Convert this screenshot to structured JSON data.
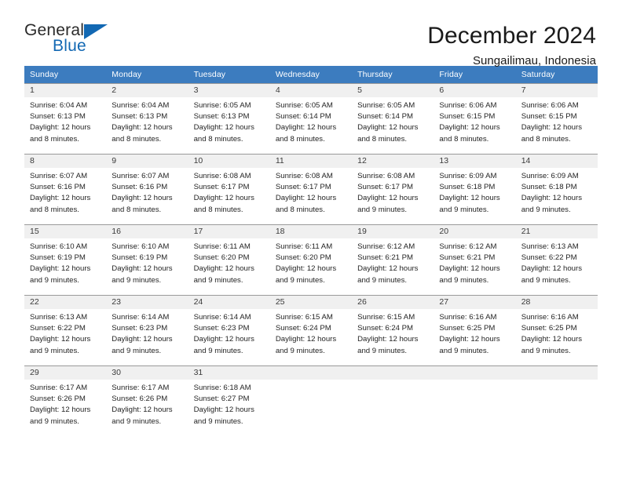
{
  "logo": {
    "primary_text": "General",
    "secondary_text": "Blue",
    "triangle_icon": "blue-triangle-icon",
    "primary_color": "#2a2a2a",
    "accent_color": "#1268b3"
  },
  "header": {
    "title": "December 2024",
    "subtitle": "Sungailimau, Indonesia"
  },
  "theme": {
    "header_blue": "#3c7cbf",
    "daynum_band": "#f0f0f0",
    "grid_line": "#9a9a9a",
    "text": "#242424"
  },
  "calendar": {
    "weekday_headers": [
      "Sunday",
      "Monday",
      "Tuesday",
      "Wednesday",
      "Thursday",
      "Friday",
      "Saturday"
    ],
    "labels": {
      "sunrise_prefix": "Sunrise:",
      "sunset_prefix": "Sunset:",
      "daylight_prefix": "Daylight:"
    },
    "weeks": [
      [
        {
          "day": "1",
          "sunrise": "Sunrise: 6:04 AM",
          "sunset": "Sunset: 6:13 PM",
          "daylight_line1": "Daylight: 12 hours",
          "daylight_line2": "and 8 minutes."
        },
        {
          "day": "2",
          "sunrise": "Sunrise: 6:04 AM",
          "sunset": "Sunset: 6:13 PM",
          "daylight_line1": "Daylight: 12 hours",
          "daylight_line2": "and 8 minutes."
        },
        {
          "day": "3",
          "sunrise": "Sunrise: 6:05 AM",
          "sunset": "Sunset: 6:13 PM",
          "daylight_line1": "Daylight: 12 hours",
          "daylight_line2": "and 8 minutes."
        },
        {
          "day": "4",
          "sunrise": "Sunrise: 6:05 AM",
          "sunset": "Sunset: 6:14 PM",
          "daylight_line1": "Daylight: 12 hours",
          "daylight_line2": "and 8 minutes."
        },
        {
          "day": "5",
          "sunrise": "Sunrise: 6:05 AM",
          "sunset": "Sunset: 6:14 PM",
          "daylight_line1": "Daylight: 12 hours",
          "daylight_line2": "and 8 minutes."
        },
        {
          "day": "6",
          "sunrise": "Sunrise: 6:06 AM",
          "sunset": "Sunset: 6:15 PM",
          "daylight_line1": "Daylight: 12 hours",
          "daylight_line2": "and 8 minutes."
        },
        {
          "day": "7",
          "sunrise": "Sunrise: 6:06 AM",
          "sunset": "Sunset: 6:15 PM",
          "daylight_line1": "Daylight: 12 hours",
          "daylight_line2": "and 8 minutes."
        }
      ],
      [
        {
          "day": "8",
          "sunrise": "Sunrise: 6:07 AM",
          "sunset": "Sunset: 6:16 PM",
          "daylight_line1": "Daylight: 12 hours",
          "daylight_line2": "and 8 minutes."
        },
        {
          "day": "9",
          "sunrise": "Sunrise: 6:07 AM",
          "sunset": "Sunset: 6:16 PM",
          "daylight_line1": "Daylight: 12 hours",
          "daylight_line2": "and 8 minutes."
        },
        {
          "day": "10",
          "sunrise": "Sunrise: 6:08 AM",
          "sunset": "Sunset: 6:17 PM",
          "daylight_line1": "Daylight: 12 hours",
          "daylight_line2": "and 8 minutes."
        },
        {
          "day": "11",
          "sunrise": "Sunrise: 6:08 AM",
          "sunset": "Sunset: 6:17 PM",
          "daylight_line1": "Daylight: 12 hours",
          "daylight_line2": "and 8 minutes."
        },
        {
          "day": "12",
          "sunrise": "Sunrise: 6:08 AM",
          "sunset": "Sunset: 6:17 PM",
          "daylight_line1": "Daylight: 12 hours",
          "daylight_line2": "and 9 minutes."
        },
        {
          "day": "13",
          "sunrise": "Sunrise: 6:09 AM",
          "sunset": "Sunset: 6:18 PM",
          "daylight_line1": "Daylight: 12 hours",
          "daylight_line2": "and 9 minutes."
        },
        {
          "day": "14",
          "sunrise": "Sunrise: 6:09 AM",
          "sunset": "Sunset: 6:18 PM",
          "daylight_line1": "Daylight: 12 hours",
          "daylight_line2": "and 9 minutes."
        }
      ],
      [
        {
          "day": "15",
          "sunrise": "Sunrise: 6:10 AM",
          "sunset": "Sunset: 6:19 PM",
          "daylight_line1": "Daylight: 12 hours",
          "daylight_line2": "and 9 minutes."
        },
        {
          "day": "16",
          "sunrise": "Sunrise: 6:10 AM",
          "sunset": "Sunset: 6:19 PM",
          "daylight_line1": "Daylight: 12 hours",
          "daylight_line2": "and 9 minutes."
        },
        {
          "day": "17",
          "sunrise": "Sunrise: 6:11 AM",
          "sunset": "Sunset: 6:20 PM",
          "daylight_line1": "Daylight: 12 hours",
          "daylight_line2": "and 9 minutes."
        },
        {
          "day": "18",
          "sunrise": "Sunrise: 6:11 AM",
          "sunset": "Sunset: 6:20 PM",
          "daylight_line1": "Daylight: 12 hours",
          "daylight_line2": "and 9 minutes."
        },
        {
          "day": "19",
          "sunrise": "Sunrise: 6:12 AM",
          "sunset": "Sunset: 6:21 PM",
          "daylight_line1": "Daylight: 12 hours",
          "daylight_line2": "and 9 minutes."
        },
        {
          "day": "20",
          "sunrise": "Sunrise: 6:12 AM",
          "sunset": "Sunset: 6:21 PM",
          "daylight_line1": "Daylight: 12 hours",
          "daylight_line2": "and 9 minutes."
        },
        {
          "day": "21",
          "sunrise": "Sunrise: 6:13 AM",
          "sunset": "Sunset: 6:22 PM",
          "daylight_line1": "Daylight: 12 hours",
          "daylight_line2": "and 9 minutes."
        }
      ],
      [
        {
          "day": "22",
          "sunrise": "Sunrise: 6:13 AM",
          "sunset": "Sunset: 6:22 PM",
          "daylight_line1": "Daylight: 12 hours",
          "daylight_line2": "and 9 minutes."
        },
        {
          "day": "23",
          "sunrise": "Sunrise: 6:14 AM",
          "sunset": "Sunset: 6:23 PM",
          "daylight_line1": "Daylight: 12 hours",
          "daylight_line2": "and 9 minutes."
        },
        {
          "day": "24",
          "sunrise": "Sunrise: 6:14 AM",
          "sunset": "Sunset: 6:23 PM",
          "daylight_line1": "Daylight: 12 hours",
          "daylight_line2": "and 9 minutes."
        },
        {
          "day": "25",
          "sunrise": "Sunrise: 6:15 AM",
          "sunset": "Sunset: 6:24 PM",
          "daylight_line1": "Daylight: 12 hours",
          "daylight_line2": "and 9 minutes."
        },
        {
          "day": "26",
          "sunrise": "Sunrise: 6:15 AM",
          "sunset": "Sunset: 6:24 PM",
          "daylight_line1": "Daylight: 12 hours",
          "daylight_line2": "and 9 minutes."
        },
        {
          "day": "27",
          "sunrise": "Sunrise: 6:16 AM",
          "sunset": "Sunset: 6:25 PM",
          "daylight_line1": "Daylight: 12 hours",
          "daylight_line2": "and 9 minutes."
        },
        {
          "day": "28",
          "sunrise": "Sunrise: 6:16 AM",
          "sunset": "Sunset: 6:25 PM",
          "daylight_line1": "Daylight: 12 hours",
          "daylight_line2": "and 9 minutes."
        }
      ],
      [
        {
          "day": "29",
          "sunrise": "Sunrise: 6:17 AM",
          "sunset": "Sunset: 6:26 PM",
          "daylight_line1": "Daylight: 12 hours",
          "daylight_line2": "and 9 minutes."
        },
        {
          "day": "30",
          "sunrise": "Sunrise: 6:17 AM",
          "sunset": "Sunset: 6:26 PM",
          "daylight_line1": "Daylight: 12 hours",
          "daylight_line2": "and 9 minutes."
        },
        {
          "day": "31",
          "sunrise": "Sunrise: 6:18 AM",
          "sunset": "Sunset: 6:27 PM",
          "daylight_line1": "Daylight: 12 hours",
          "daylight_line2": "and 9 minutes."
        },
        {
          "day": "",
          "sunrise": "",
          "sunset": "",
          "daylight_line1": "",
          "daylight_line2": ""
        },
        {
          "day": "",
          "sunrise": "",
          "sunset": "",
          "daylight_line1": "",
          "daylight_line2": ""
        },
        {
          "day": "",
          "sunrise": "",
          "sunset": "",
          "daylight_line1": "",
          "daylight_line2": ""
        },
        {
          "day": "",
          "sunrise": "",
          "sunset": "",
          "daylight_line1": "",
          "daylight_line2": ""
        }
      ]
    ]
  }
}
